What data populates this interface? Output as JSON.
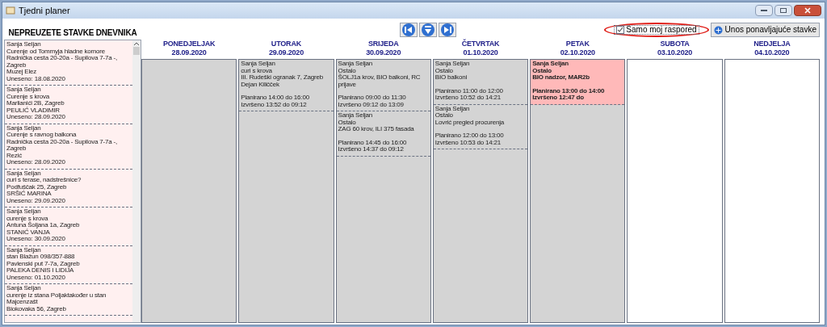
{
  "window": {
    "title": "Tjedni planer"
  },
  "sidebar": {
    "title": "NEPREUZETE STAVKE DNEVNIKA",
    "items": [
      {
        "lines": [
          "Sanja Seljan",
          "Curenje od Tommyja hladne komore",
          "Radnička cesta 20-20a - Supilova 7-7a -, Zagreb",
          "Muzej Elez",
          "Uneseno: 18.08.2020"
        ]
      },
      {
        "lines": [
          "Sanja Seljan",
          "Curenje s krova",
          "Marlianići 2B, Zagreb",
          "PEULIĆ VLADIMIR",
          "Uneseno: 28.09.2020"
        ]
      },
      {
        "lines": [
          "Sanja Seljan",
          "Curenje s ravnog balkona",
          "Radnička cesta 20-20a - Supilova 7-7a -, Zagreb",
          "Rezić",
          "Uneseno: 28.09.2020"
        ]
      },
      {
        "lines": [
          "Sanja Seljan",
          "curi s terase, nadstrešnice?",
          "Podfuščak 25, Zagreb",
          "SRŠIĆ MARINA",
          "Uneseno: 29.09.2020"
        ]
      },
      {
        "lines": [
          "Sanja Seljan",
          "curenje s krova",
          "Antuna Šoljana 1a, Zagreb",
          "STANIĆ VANJA",
          "Uneseno: 30.09.2020"
        ]
      },
      {
        "lines": [
          "Sanja Seljan",
          "stan Blažun 098/357-888",
          "Pavlenski put 7-7a, Zagreb",
          "PALEKA DENIS I LIDIJA",
          "Uneseno: 01.10.2020"
        ]
      },
      {
        "lines": [
          "Sanja Seljan",
          "curenje iz stana Poljaktakođer u stan Majcenzašt",
          "Biokovaka 56, Zagreb"
        ]
      }
    ]
  },
  "toolbar": {
    "nav_buttons": [
      {
        "kind": "prev"
      },
      {
        "kind": "down"
      },
      {
        "kind": "next"
      }
    ],
    "checkbox": {
      "label": "Samo moj raspored",
      "checked": true
    },
    "button": {
      "label": "Unos ponavljajuće stavke"
    }
  },
  "days": [
    {
      "name": "PONEDJELJAK",
      "date": "28.09.2020",
      "weekend": false
    },
    {
      "name": "UTORAK",
      "date": "29.09.2020",
      "weekend": false,
      "entries": [
        {
          "highlighted": false,
          "lines": [
            "Sanja Seljan",
            "curi s krova",
            "III. Rudeški ogranak 7, Zagreb",
            "Dejan Kiličček"
          ],
          "times": [
            "Planirano 14:00 do 16:00",
            "Izvršeno 13:52 do 09:12"
          ]
        }
      ]
    },
    {
      "name": "SRIJEDA",
      "date": "30.09.2020",
      "weekend": false,
      "entries": [
        {
          "highlighted": false,
          "lines": [
            "Sanja Seljan",
            "Ostalo",
            "ŠOLJ1a krov, BIO balkoni, RC prijave"
          ],
          "times": [
            "Planirano 09:00 do 11:30",
            "Izvršeno 09:12 do 13:09"
          ]
        },
        {
          "highlighted": false,
          "lines": [
            "Sanja Seljan",
            "Ostalo",
            "ZAG 60 krov, ILI 375 fasada"
          ],
          "times": [
            "Planirano 14:45 do 16:00",
            "Izvršeno 14:37 do 09:12"
          ]
        }
      ]
    },
    {
      "name": "ČETVRTAK",
      "date": "01.10.2020",
      "weekend": false,
      "entries": [
        {
          "highlighted": false,
          "lines": [
            "Sanja Seljan",
            "Ostalo",
            "BIO balkoni"
          ],
          "times": [
            "Planirano 11:00 do 12:00",
            "Izvršeno 10:52 do 14:21"
          ]
        },
        {
          "highlighted": false,
          "lines": [
            "Sanja Seljan",
            "Ostalo",
            "Lovrić pregled procurenja"
          ],
          "times": [
            "Planirano 12:00 do 13:00",
            "Izvršeno 10:53 do 14:21"
          ]
        }
      ]
    },
    {
      "name": "PETAK",
      "date": "02.10.2020",
      "weekend": false,
      "entries": [
        {
          "highlighted": true,
          "lines": [
            "Sanja Seljan",
            "Ostalo",
            "BIO nadzor, MAR2b"
          ],
          "times": [
            "Planirano 13:00 do 14:00",
            "Izvršeno 12:47 do"
          ]
        }
      ]
    },
    {
      "name": "SUBOTA",
      "date": "03.10.2020",
      "weekend": true
    },
    {
      "name": "NEDJELJA",
      "date": "04.10.2020",
      "weekend": true
    }
  ]
}
